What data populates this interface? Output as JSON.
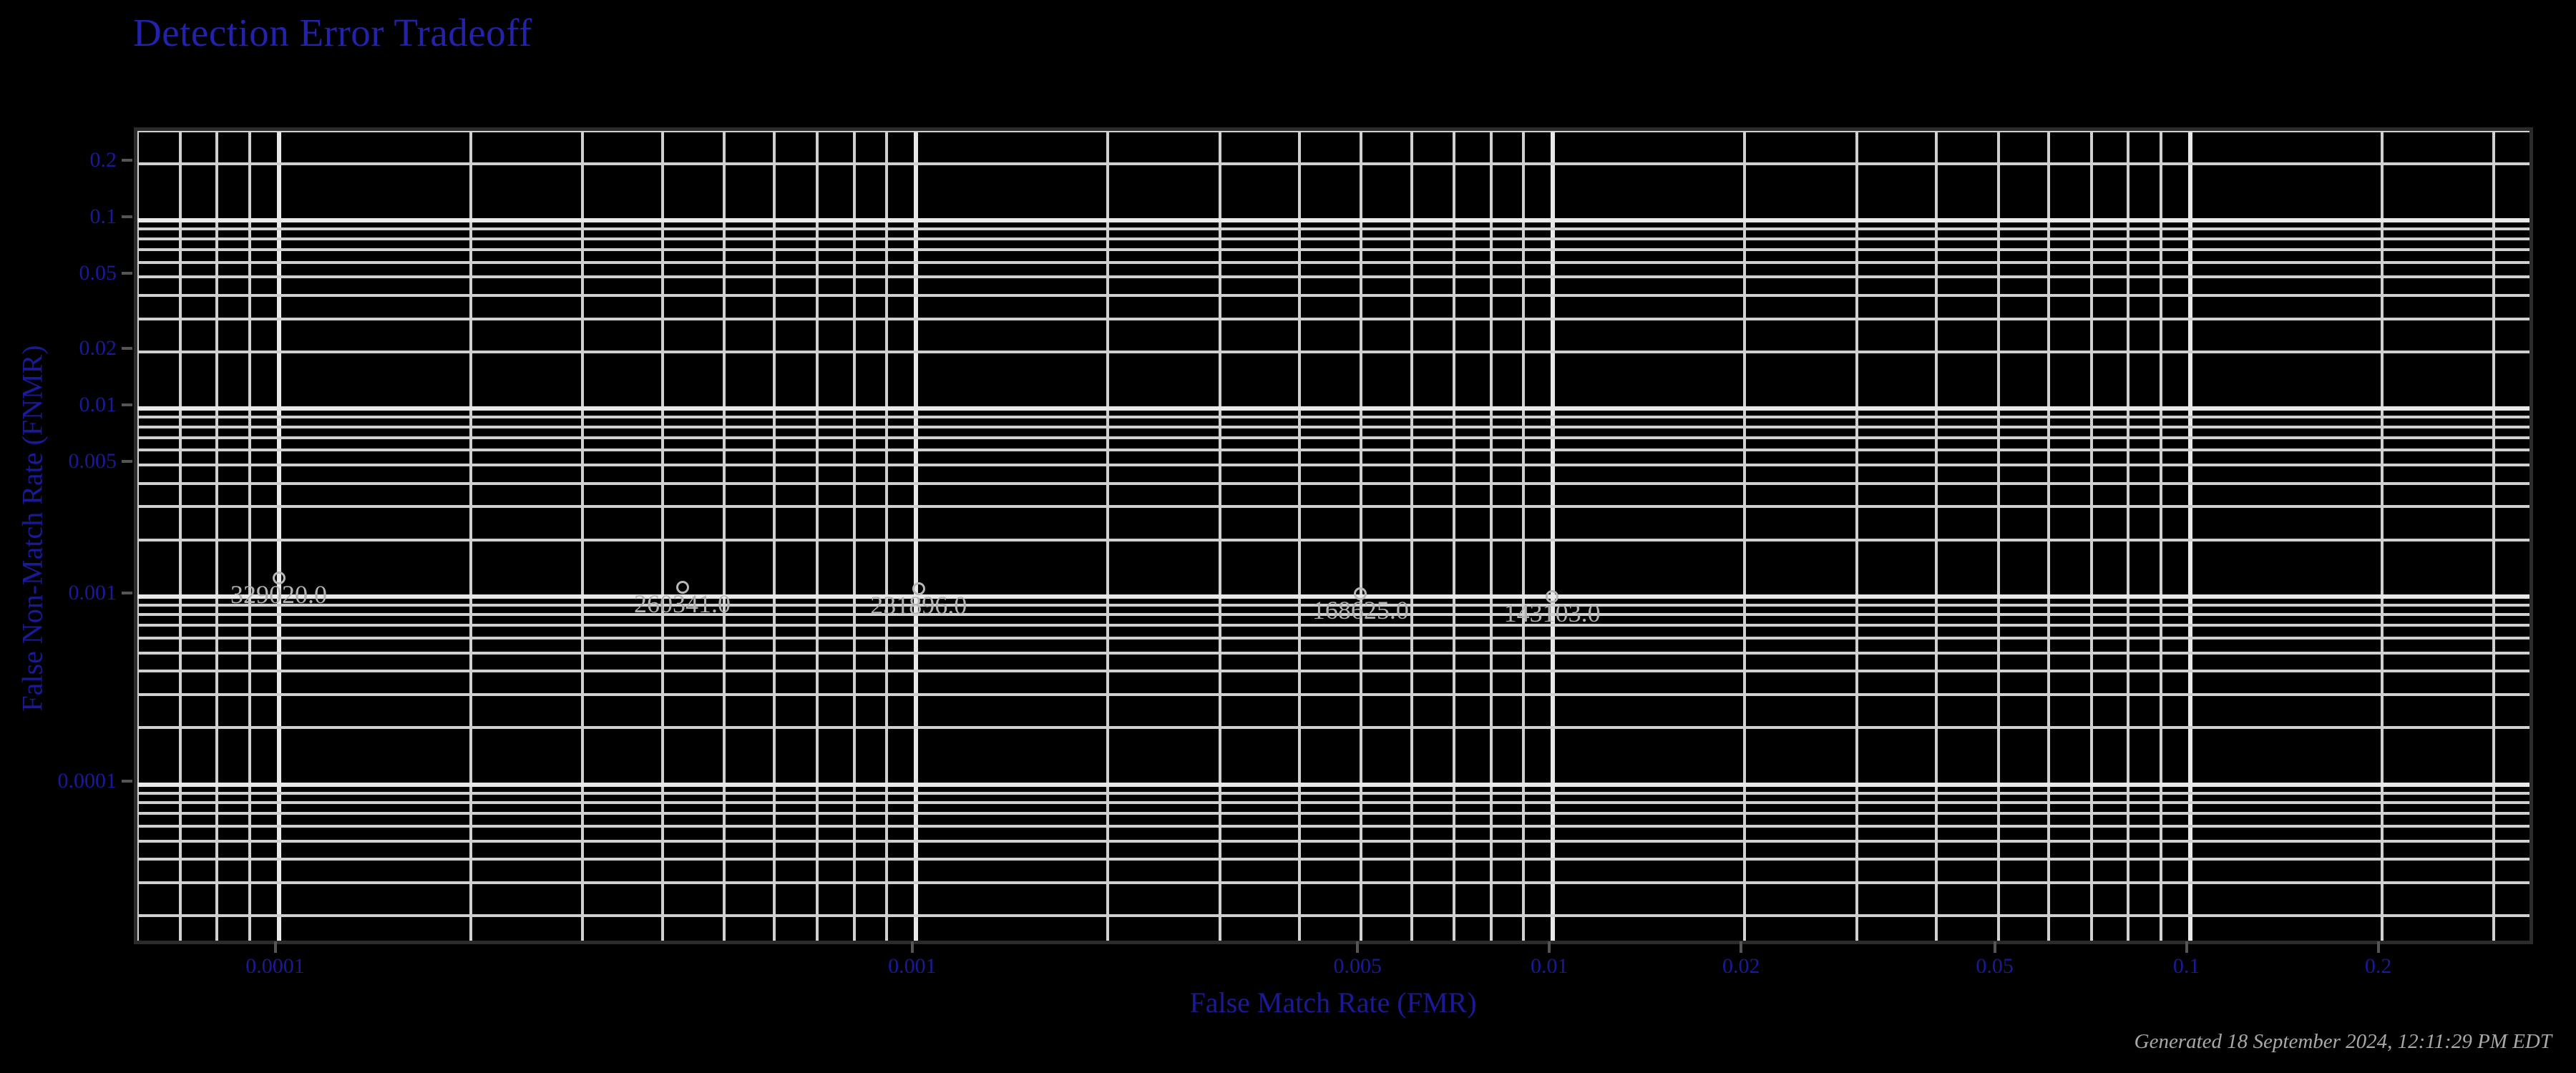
{
  "chart_data": {
    "type": "scatter",
    "title": "Detection Error Tradeoff",
    "xlabel": "False Match Rate (FMR)",
    "ylabel": "False Non-Match Rate (FNMR)",
    "xscale": "log",
    "yscale": "log",
    "xlim": [
      6e-05,
      0.35
    ],
    "ylim": [
      1.35e-05,
      0.3
    ],
    "grid": true,
    "legend": "none",
    "xticks": [
      "0.0001",
      "0.001",
      "0.005",
      "0.01",
      "0.02",
      "0.05",
      "0.1",
      "0.2"
    ],
    "xtick_values": [
      0.0001,
      0.001,
      0.005,
      0.01,
      0.02,
      0.05,
      0.1,
      0.2
    ],
    "yticks": [
      "0.2",
      "0.1",
      "0.05",
      "0.02",
      "0.01",
      "0.005",
      "0.001",
      "0.0001"
    ],
    "ytick_values": [
      0.2,
      0.1,
      0.05,
      0.02,
      0.01,
      0.005,
      0.001,
      0.0001
    ],
    "points": [
      {
        "label": "329020.0",
        "x": 0.0001,
        "y": 0.00125
      },
      {
        "label": "260341.0",
        "x": 0.00043,
        "y": 0.00112
      },
      {
        "label": "231896.0",
        "x": 0.00101,
        "y": 0.0011
      },
      {
        "label": "168625.0",
        "x": 0.00499,
        "y": 0.00103
      },
      {
        "label": "143103.0",
        "x": 0.00997,
        "y": 0.001
      }
    ],
    "annotations": [
      "329020.0",
      "260341.0",
      "231896.0",
      "168625.0",
      "143103.0"
    ]
  },
  "footer": {
    "generated": "Generated 18 September 2024, 12:11:29 PM EDT"
  },
  "colors": {
    "background": "#000000",
    "title": "#2222aa",
    "axis_label": "#1a1a99",
    "tick_label": "#1a1a99",
    "grid_major": "#e8e8e8",
    "grid_minor": "#d0d0d0",
    "marker": "#b8b8b8",
    "data_label": "#b3b3b3",
    "frame": "#2b2b2b",
    "footer": "#a8a8a8"
  }
}
